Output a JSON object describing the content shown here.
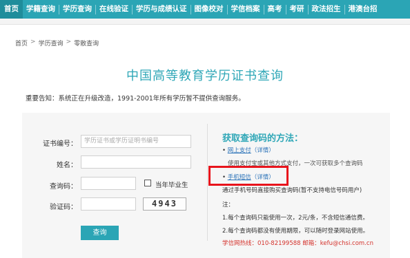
{
  "nav": {
    "items": [
      "首页",
      "学籍查询",
      "学历查询",
      "在线验证",
      "学历与成绩认证",
      "图像校对",
      "学信档案",
      "高考",
      "考研",
      "政法招生",
      "港澳台招"
    ]
  },
  "breadcrumb": [
    "首页",
    "学历查询",
    "零散查询"
  ],
  "breadcrumb_sep": ">",
  "page_title": "中国高等教育学历证书查询",
  "notice": "重要告知：系统正在升级改造，1991-2001年所有学历暂不提供查询服务。",
  "form": {
    "cert_label": "证书编号：",
    "cert_placeholder": "学历证书或学历证明书编号",
    "name_label": "姓名：",
    "query_code_label": "查询码：",
    "graduate_label": "当年毕业生",
    "verify_label": "验证码：",
    "captcha_text": "4943",
    "query_button": "查询"
  },
  "methods": {
    "title": "获取查询码的方法：",
    "bullet": "•",
    "online_pay": "网上支付",
    "detail": "（详情）",
    "online_pay_desc": "使用支付宝或其他方式支付，一次可获取多个查询码",
    "sms": "手机短信",
    "sms_desc": "通过手机号码直接购买查询码(暂不支持电信号码用户)",
    "note_label": "注：",
    "note1": "1.每个查询码只能使用一次，2元/条，不含短信通信费。",
    "note2": "2.每个查询码都没有使用期限，可以随时登录网站使用。",
    "hotline": "学信网热线：010-82199588   邮箱：kefu@chsi.com.cn"
  },
  "colors": {
    "accent": "#2ba5b5",
    "title": "#2fa7b7",
    "highlight": "#e8141c",
    "link": "#2a72b8"
  }
}
